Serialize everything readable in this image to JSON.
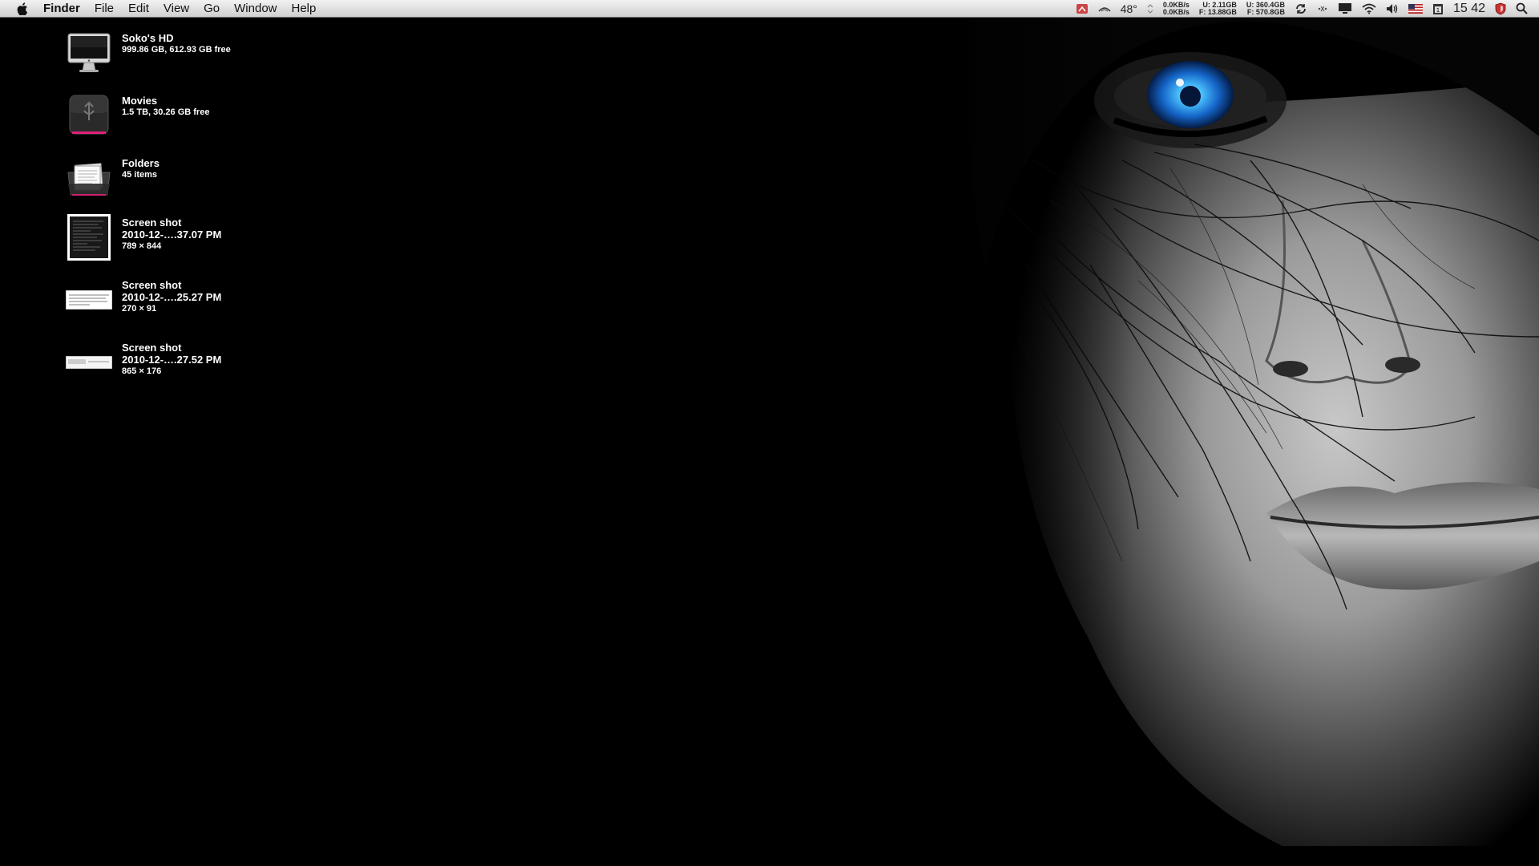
{
  "menubar": {
    "app_name": "Finder",
    "menus": [
      "File",
      "Edit",
      "View",
      "Go",
      "Window",
      "Help"
    ],
    "status": {
      "temperature": "48°",
      "net_up": "0.0KB/s",
      "net_down": "0.0KB/s",
      "mem_used": "U: 2.11GB",
      "mem_free": "F: 13.88GB",
      "disk_used": "U: 360.4GB",
      "disk_free": "F: 570.8GB",
      "clock": "15 42",
      "icons": [
        "gauge-icon",
        "fan-icon",
        "sync-icon",
        "bluetooth-icon",
        "display-icon",
        "wifi-icon",
        "volume-icon",
        "flag-us-icon",
        "calendar-icon",
        "shield-icon",
        "spotlight-icon"
      ]
    }
  },
  "desktop": {
    "items": [
      {
        "name": "Soko's HD",
        "info1": "999.86 GB, 612.93 GB free",
        "info2": "",
        "icon": "imac-drive-icon"
      },
      {
        "name": "Movies",
        "info1": "1.5 TB, 30.26 GB free",
        "info2": "",
        "icon": "firewire-drive-icon"
      },
      {
        "name": "Folders",
        "info1": "45 items",
        "info2": "",
        "icon": "folder-stack-icon"
      },
      {
        "name": "Screen shot",
        "info1": "2010-12-….37.07 PM",
        "info2": "789 × 844",
        "icon": "screenshot-thumbnail-icon"
      },
      {
        "name": "Screen shot",
        "info1": "2010-12-….25.27 PM",
        "info2": "270 × 91",
        "icon": "screenshot-thumbnail-icon"
      },
      {
        "name": "Screen shot",
        "info1": "2010-12-….27.52 PM",
        "info2": "865 × 176",
        "icon": "screenshot-thumbnail-icon"
      }
    ]
  }
}
